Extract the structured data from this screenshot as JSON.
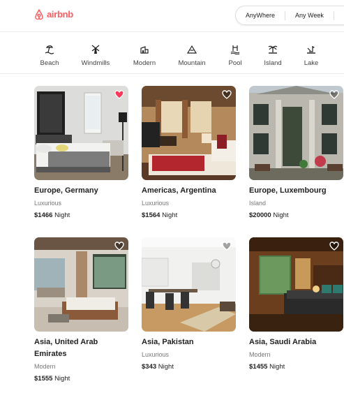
{
  "brand": {
    "name": "airbnb",
    "color": "#ff5a5f"
  },
  "search": {
    "where": "AnyWhere",
    "week": "Any Week"
  },
  "categories": [
    {
      "label": "Beach",
      "icon": "beach-icon"
    },
    {
      "label": "Windmills",
      "icon": "windmill-icon"
    },
    {
      "label": "Modern",
      "icon": "modern-house-icon"
    },
    {
      "label": "Mountain",
      "icon": "mountain-icon"
    },
    {
      "label": "Pool",
      "icon": "pool-icon"
    },
    {
      "label": "Island",
      "icon": "island-icon"
    },
    {
      "label": "Lake",
      "icon": "lake-icon"
    }
  ],
  "listings": [
    {
      "title": "Europe, Germany",
      "category": "Luxurious",
      "price": "$1466",
      "unit": "Night",
      "favorited": true
    },
    {
      "title": "Americas, Argentina",
      "category": "Luxurious",
      "price": "$1564",
      "unit": "Night",
      "favorited": false
    },
    {
      "title": "Europe, Luxembourg",
      "category": "Island",
      "price": "$20000",
      "unit": "Night",
      "favorited": false
    },
    {
      "title": "Asia, United Arab Emirates",
      "category": "Modern",
      "price": "$1555",
      "unit": "Night",
      "favorited": false
    },
    {
      "title": "Asia, Pakistan",
      "category": "Luxurious",
      "price": "$343",
      "unit": "Night",
      "favorited": false
    },
    {
      "title": "Asia, Saudi Arabia",
      "category": "Modern",
      "price": "$1455",
      "unit": "Night",
      "favorited": false
    }
  ]
}
